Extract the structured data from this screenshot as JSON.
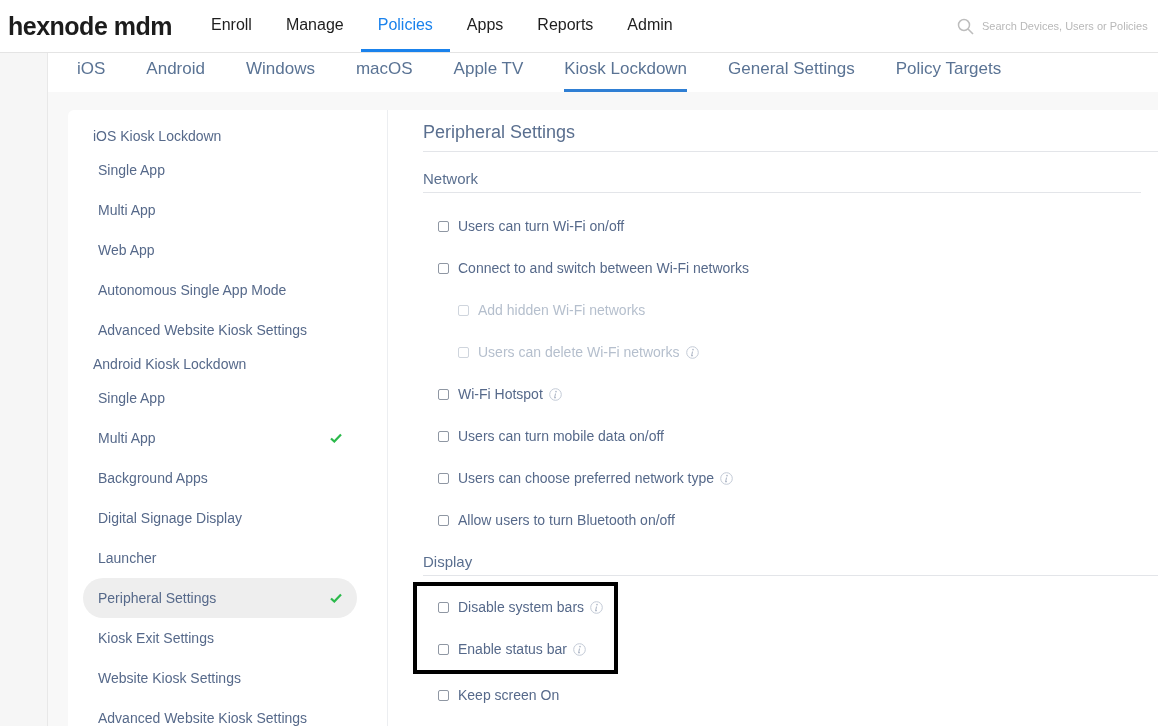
{
  "header": {
    "logo": "hexnode mdm",
    "nav": [
      {
        "label": "Enroll",
        "selected": false
      },
      {
        "label": "Manage",
        "selected": false
      },
      {
        "label": "Policies",
        "selected": true
      },
      {
        "label": "Apps",
        "selected": false
      },
      {
        "label": "Reports",
        "selected": false
      },
      {
        "label": "Admin",
        "selected": false
      }
    ],
    "search": {
      "placeholder": "Search Devices, Users or Policies"
    }
  },
  "tabs": [
    {
      "label": "iOS",
      "selected": false
    },
    {
      "label": "Android",
      "selected": false
    },
    {
      "label": "Windows",
      "selected": false
    },
    {
      "label": "macOS",
      "selected": false
    },
    {
      "label": "Apple TV",
      "selected": false
    },
    {
      "label": "Kiosk Lockdown",
      "selected": true
    },
    {
      "label": "General Settings",
      "selected": false
    },
    {
      "label": "Policy Targets",
      "selected": false
    }
  ],
  "sidebar": {
    "groups": [
      {
        "heading": "iOS Kiosk Lockdown",
        "items": [
          {
            "label": "Single App",
            "selected": false,
            "configured": false
          },
          {
            "label": "Multi App",
            "selected": false,
            "configured": false
          },
          {
            "label": "Web App",
            "selected": false,
            "configured": false
          },
          {
            "label": "Autonomous Single App Mode",
            "selected": false,
            "configured": false
          },
          {
            "label": "Advanced Website Kiosk Settings",
            "selected": false,
            "configured": false
          }
        ]
      },
      {
        "heading": "Android Kiosk Lockdown",
        "items": [
          {
            "label": "Single App",
            "selected": false,
            "configured": false
          },
          {
            "label": "Multi App",
            "selected": false,
            "configured": true
          },
          {
            "label": "Background Apps",
            "selected": false,
            "configured": false
          },
          {
            "label": "Digital Signage Display",
            "selected": false,
            "configured": false
          },
          {
            "label": "Launcher",
            "selected": false,
            "configured": false
          },
          {
            "label": "Peripheral Settings",
            "selected": true,
            "configured": true
          },
          {
            "label": "Kiosk Exit Settings",
            "selected": false,
            "configured": false
          },
          {
            "label": "Website Kiosk Settings",
            "selected": false,
            "configured": false
          },
          {
            "label": "Advanced Website Kiosk Settings",
            "selected": false,
            "configured": false
          }
        ]
      }
    ]
  },
  "content": {
    "title": "Peripheral Settings",
    "sections": [
      {
        "heading": "Network",
        "options": [
          {
            "label": "Users can turn Wi-Fi on/off",
            "checked": false,
            "disabled": false,
            "info": false,
            "highlighted": false
          },
          {
            "label": "Connect to and switch between Wi-Fi networks",
            "checked": false,
            "disabled": false,
            "info": false,
            "highlighted": false,
            "children": [
              {
                "label": "Add hidden Wi-Fi networks",
                "checked": false,
                "disabled": true,
                "info": false,
                "highlighted": false
              },
              {
                "label": "Users can delete Wi-Fi networks",
                "checked": false,
                "disabled": true,
                "info": true,
                "highlighted": false
              }
            ]
          },
          {
            "label": "Wi-Fi Hotspot",
            "checked": false,
            "disabled": false,
            "info": true,
            "highlighted": false
          },
          {
            "label": "Users can turn mobile data on/off",
            "checked": false,
            "disabled": false,
            "info": false,
            "highlighted": false
          },
          {
            "label": "Users can choose preferred network type",
            "checked": false,
            "disabled": false,
            "info": true,
            "highlighted": false
          },
          {
            "label": "Allow users to turn Bluetooth on/off",
            "checked": false,
            "disabled": false,
            "info": false,
            "highlighted": false
          }
        ]
      },
      {
        "heading": "Display",
        "options": [
          {
            "label": "Disable system bars",
            "checked": false,
            "disabled": false,
            "info": true,
            "highlighted": true
          },
          {
            "label": "Enable status bar",
            "checked": false,
            "disabled": false,
            "info": true,
            "highlighted": true
          },
          {
            "label": "Keep screen On",
            "checked": false,
            "disabled": false,
            "info": false,
            "highlighted": false
          }
        ]
      }
    ]
  }
}
